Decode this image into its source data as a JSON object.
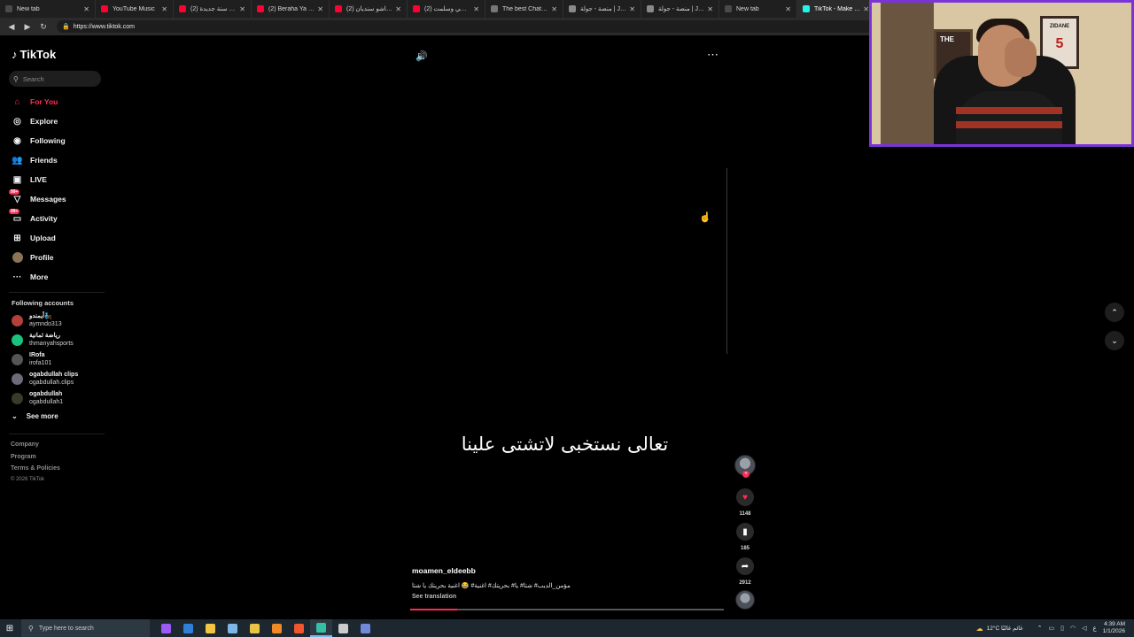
{
  "browser": {
    "tabs": [
      {
        "label": "New tab",
        "color": "#4a4a4a"
      },
      {
        "label": "YouTube Music",
        "color": "#ff0033"
      },
      {
        "label": "(2) سنة جديدة - YouTube",
        "color": "#ff0033"
      },
      {
        "label": "(2) Beraha Ya Sheekha",
        "color": "#ff0033"
      },
      {
        "label": "(2) ميوزر باشو سنديان",
        "color": "#ff0033"
      },
      {
        "label": "(2) ولدت ساطي وسلمت",
        "color": "#ff0033"
      },
      {
        "label": "The best ChatBot and",
        "color": "#777777"
      },
      {
        "label": "منصة - جولة | Jawlah",
        "color": "#8a8a8a"
      },
      {
        "label": "منصة - جولة | Jawlah",
        "color": "#8a8a8a"
      },
      {
        "label": "New tab",
        "color": "#4a4a4a"
      },
      {
        "label": "TikTok - Make Yo",
        "color": "#25f4ee"
      }
    ],
    "url": "https://www.tiktok.com"
  },
  "sidebar": {
    "logo": "TikTok",
    "search_placeholder": "Search",
    "nav": [
      {
        "label": "For You",
        "icon": "home-icon"
      },
      {
        "label": "Explore",
        "icon": "compass-icon"
      },
      {
        "label": "Following",
        "icon": "following-icon"
      },
      {
        "label": "Friends",
        "icon": "friends-icon"
      },
      {
        "label": "LIVE",
        "icon": "live-icon"
      },
      {
        "label": "Messages",
        "icon": "messages-icon",
        "badge": "99+"
      },
      {
        "label": "Activity",
        "icon": "activity-icon",
        "badge": "99+"
      },
      {
        "label": "Upload",
        "icon": "upload-icon"
      },
      {
        "label": "Profile",
        "icon": "profile-icon"
      },
      {
        "label": "More",
        "icon": "more-icon"
      }
    ],
    "following_title": "Following accounts",
    "accounts": [
      {
        "name": "أيمندو🧞",
        "handle": "aymndo313",
        "color": "#b3403a"
      },
      {
        "name": "رياضة ثمانية",
        "handle": "thmanyahsports",
        "color": "#19c37d"
      },
      {
        "name": "IRofa",
        "handle": "irofa101",
        "color": "#555555"
      },
      {
        "name": "ogabdullah clips",
        "handle": "ogabdullah.clips",
        "color": "#6b6b7a"
      },
      {
        "name": "ogabdullah",
        "handle": "ogabdullah1",
        "color": "#3a3a2a"
      }
    ],
    "see_more": "See more",
    "footer": [
      "Company",
      "Program",
      "Terms & Policies"
    ],
    "copyright": "© 2026 TikTok"
  },
  "video": {
    "caption": "تعالى نستخبى لاتشتى علينا",
    "author": "moamen_eldeebb",
    "description": "مؤمن_الديب# شتا# يا# بحريتك# اغنية# 😂 اغنية بحريتك يا شتا",
    "see_translation": "See translation",
    "progress": 0.15,
    "likes": "1148",
    "saves": "185",
    "shares": "2912"
  },
  "webcam": {
    "frame_left_text": "THE",
    "frame_right_text": "ZIDANE",
    "frame_right_number": "5"
  },
  "taskbar": {
    "search_placeholder": "Type here to search",
    "apps": [
      {
        "icon": "premiere-icon",
        "color": "#9b59f5"
      },
      {
        "icon": "photoshop-icon",
        "color": "#2f7fd8"
      },
      {
        "icon": "file-explorer-icon",
        "color": "#f4c542"
      },
      {
        "icon": "app-icon",
        "color": "#7eb6e8"
      },
      {
        "icon": "chrome-icon",
        "color": "#e9c544"
      },
      {
        "icon": "vlc-icon",
        "color": "#f08a24"
      },
      {
        "icon": "brave-icon",
        "color": "#f2562d"
      },
      {
        "icon": "edge-icon",
        "color": "#35c0a6"
      },
      {
        "icon": "obs-icon",
        "color": "#cccccc"
      },
      {
        "icon": "discord-icon",
        "color": "#7289da"
      }
    ],
    "weather": "12°C غائم غالبًا",
    "lang": "ع",
    "time": "4:39 AM",
    "date": "1/1/2026"
  }
}
